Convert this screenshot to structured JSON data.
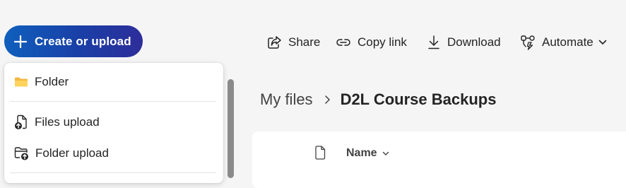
{
  "create_button": {
    "label": "Create or upload",
    "icon": "plus-icon"
  },
  "toolbar": {
    "share": {
      "label": "Share",
      "icon": "share-icon"
    },
    "copy_link": {
      "label": "Copy link",
      "icon": "link-icon"
    },
    "download": {
      "label": "Download",
      "icon": "download-icon"
    },
    "automate": {
      "label": "Automate",
      "icon": "automate-icon"
    }
  },
  "create_menu": {
    "items": [
      {
        "label": "Folder",
        "icon": "folder-icon"
      },
      {
        "label": "Files upload",
        "icon": "file-upload-icon"
      },
      {
        "label": "Folder upload",
        "icon": "folder-upload-icon"
      }
    ]
  },
  "breadcrumb": {
    "root": "My files",
    "current": "D2L Course Backups"
  },
  "file_list": {
    "columns": {
      "name": "Name"
    }
  },
  "colors": {
    "accent_start": "#0f5fbd",
    "accent_end": "#2d2d9a",
    "folder": "#f4b83f"
  }
}
